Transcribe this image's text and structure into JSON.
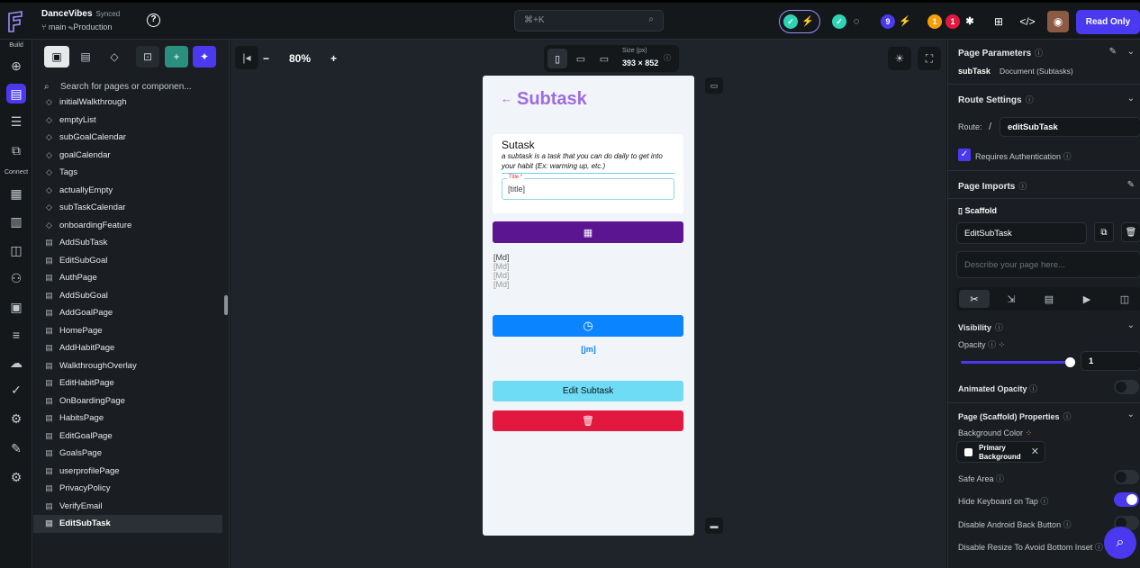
{
  "topbar": {
    "project_name": "DanceVibes",
    "sync_status": "Synced",
    "branch": "main",
    "environment": "Production",
    "search_shortcut": "⌘+K",
    "badge_count_a": "9",
    "badge_count_b": "1",
    "badge_count_c": "1",
    "read_only_label": "Read Only",
    "accent": "#4b39ef"
  },
  "rail": {
    "build_label": "Build",
    "connect_label": "Connect"
  },
  "tree": {
    "search_placeholder": "Search for pages or componen...",
    "items": [
      {
        "label": "initialWalkthrough",
        "type": "component"
      },
      {
        "label": "emptyList",
        "type": "component"
      },
      {
        "label": "subGoalCalendar",
        "type": "component"
      },
      {
        "label": "goalCalendar",
        "type": "component"
      },
      {
        "label": "Tags",
        "type": "component"
      },
      {
        "label": "actuallyEmpty",
        "type": "component"
      },
      {
        "label": "subTaskCalendar",
        "type": "component"
      },
      {
        "label": "onboardingFeature",
        "type": "component"
      },
      {
        "label": "AddSubTask",
        "type": "page"
      },
      {
        "label": "EditSubGoal",
        "type": "page"
      },
      {
        "label": "AuthPage",
        "type": "page"
      },
      {
        "label": "AddSubGoal",
        "type": "page"
      },
      {
        "label": "AddGoalPage",
        "type": "page"
      },
      {
        "label": "HomePage",
        "type": "page"
      },
      {
        "label": "AddHabitPage",
        "type": "page"
      },
      {
        "label": "WalkthroughOverlay",
        "type": "page"
      },
      {
        "label": "EditHabitPage",
        "type": "page"
      },
      {
        "label": "OnBoardingPage",
        "type": "page"
      },
      {
        "label": "HabitsPage",
        "type": "page"
      },
      {
        "label": "EditGoalPage",
        "type": "page"
      },
      {
        "label": "GoalsPage",
        "type": "page"
      },
      {
        "label": "userprofilePage",
        "type": "page"
      },
      {
        "label": "PrivacyPolicy",
        "type": "page"
      },
      {
        "label": "VerifyEmail",
        "type": "page"
      },
      {
        "label": "EditSubTask",
        "type": "page",
        "selected": true
      }
    ]
  },
  "canvas": {
    "zoom": "80%",
    "size_label": "Size (px)",
    "size_value": "393 × 852"
  },
  "phone": {
    "title": "Subtask",
    "card_title": "Sutask",
    "card_desc": "a subtask is a task that you can do daily to get into your habit (Ex: warming up, etc.)",
    "input_label": "Title *",
    "input_value": "[title]",
    "md_lines": [
      "[Md]",
      "[Md]",
      "[Md]",
      "[Md]"
    ],
    "time_value": "[jm]",
    "edit_button": "Edit Subtask",
    "colors": {
      "purple_btn": "#5b1591",
      "blue_btn": "#0a84ff",
      "edit_btn": "#6fdcf5",
      "delete_btn": "#e3183f",
      "title": "#9c6ce0"
    }
  },
  "props": {
    "page_params_header": "Page Parameters",
    "page_name": "subTask",
    "page_type": "Document (Subtasks)",
    "route_header": "Route Settings",
    "route_label": "Route:",
    "route_slash": "/",
    "route_value": "editSubTask",
    "requires_auth": "Requires Authentication",
    "imports_header": "Page Imports",
    "scaffold_label": "Scaffold",
    "page_name_value": "EditSubTask",
    "describe_placeholder": "Describe your page here...",
    "visibility_header": "Visibility",
    "opacity_label": "Opacity",
    "opacity_value": "1",
    "animated_opacity": "Animated Opacity",
    "scaffold_props_header": "Page (Scaffold) Properties",
    "bg_color_label": "Background Color",
    "bg_color_value_1": "Primary",
    "bg_color_value_2": "Background",
    "safe_area": "Safe Area",
    "hide_keyboard": "Hide Keyboard on Tap",
    "disable_back": "Disable Android Back Button",
    "disable_resize": "Disable Resize To Avoid Bottom Inset"
  }
}
